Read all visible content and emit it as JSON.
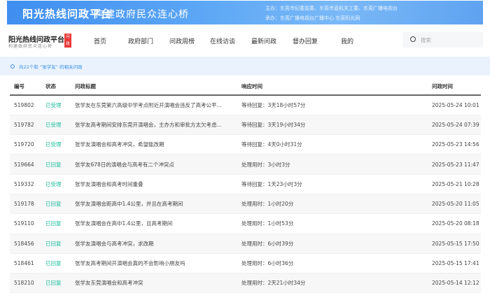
{
  "banner": {
    "title": "阳光热线问政平台",
    "slogan": "构建政府民众连心桥",
    "sponsor": "主办：东莞市纪委监委、东莞市直机关工委、东莞广播电视台",
    "organizer": "承办：东莞广播电视台广播中心 东莞阳光网"
  },
  "logo": {
    "title": "阳光热线问政平台",
    "subtitle": "构建政府民众连心桥",
    "badge": "问政"
  },
  "nav": [
    "首页",
    "政府部门",
    "问政周榜",
    "在线访谈",
    "最新问政",
    "督办回复",
    "我的"
  ],
  "search": {
    "placeholder": "搜索"
  },
  "info": "共22个和 “张学友” 的相关问政",
  "table": {
    "headers": [
      "编号",
      "状态",
      "问政标题",
      "响应时间",
      "问政时间"
    ],
    "rows": [
      [
        "519802",
        "已受理",
        "张学友在东莞第六高级中学考点附近开演唱会违反了高考公平...",
        "等待回复：3天18小时57分",
        "2025-05-24 10:01"
      ],
      [
        "519782",
        "已受理",
        "张学友高考期间安排东莞开演唱会，主办方和审批方太欠考虑...",
        "等待回复：3天19小时34分",
        "2025-05-24 07:39"
      ],
      [
        "519720",
        "已受理",
        "张学友演唱会和高考冲突，希望能改期",
        "等待回复：4天0小时31分",
        "2025-05-23 14:56"
      ],
      [
        "519664",
        "已回复",
        "张学友678日的演唱会与高考有二个冲突点",
        "处理用时：3小时3分",
        "2025-05-23 11:47"
      ],
      [
        "519332",
        "已受理",
        "张学友演唱会和高考时间重叠",
        "等待回复：1天23小时3分",
        "2025-05-21 10:28"
      ],
      [
        "519178",
        "已回复",
        "张学友演唱会距高中1.4公里，并且在高考期间",
        "处理用时：1小时20分",
        "2025-05-20 11:05"
      ],
      [
        "519110",
        "已回复",
        "张学友演唱会在高中1.4公里，且高考期间",
        "处理用时：1小时53分",
        "2025-05-20 08:18"
      ],
      [
        "518456",
        "已回复",
        "张学友演唱会与高考冲突，求改期",
        "处理用时：6小时39分",
        "2025-05-15 17:50"
      ],
      [
        "518461",
        "已回复",
        "张学友高考期间开演唱会真的不会影响小朋友吗",
        "处理用时：6小时36分",
        "2025-05-15 17:41"
      ],
      [
        "518210",
        "已回复",
        "张学友东莞演唱会和高考冲突",
        "处理用时：2天21小时34分",
        "2025-05-14 12:12"
      ]
    ]
  }
}
